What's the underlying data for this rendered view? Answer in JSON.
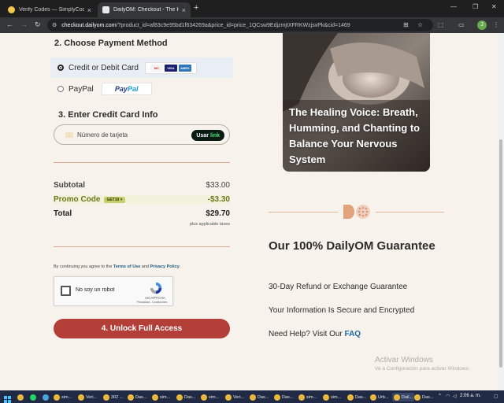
{
  "browser": {
    "tabs": [
      {
        "title": "Verify Codes — SimplyCodes",
        "active": false
      },
      {
        "title": "DailyOM: Checkout - The Heali",
        "active": true
      }
    ],
    "url_host": "checkout.dailyom.com",
    "url_rest": "/?product_id=af83c9e95bd1f634269a&price_id=price_1QCsw9EdjzmjtXFRKWzjsxPk&cid=1469"
  },
  "payment": {
    "section_title": "2. Choose Payment Method",
    "options": [
      {
        "label": "Credit or Debit Card",
        "selected": true
      },
      {
        "label": "PayPal",
        "selected": false
      }
    ],
    "card_brands": [
      "MC",
      "VISA",
      "AMEX"
    ],
    "paypal_logo": [
      "Pay",
      "Pal"
    ]
  },
  "card_info": {
    "section_title": "3. Enter Credit Card Info",
    "placeholder": "Número de tarjeta",
    "link_button": {
      "prefix": "Usar",
      "brand": "link"
    }
  },
  "summary": {
    "subtotal_label": "Subtotal",
    "subtotal_value": "$33.00",
    "promo_label": "Promo Code",
    "promo_code": "GET10 ×",
    "promo_value": "-$3.30",
    "total_label": "Total",
    "total_value": "$29.70",
    "taxes_note": "plus applicable taxes"
  },
  "terms": {
    "prefix": "By continuing you agree to the ",
    "terms_link": "Terms of Use",
    "and": " and ",
    "privacy_link": "Privacy Policy",
    "suffix": "."
  },
  "captcha": {
    "label": "No soy un robot",
    "brand": "reCAPTCHA",
    "privacy": "Privacidad - Condiciones"
  },
  "cta": {
    "label": "4. Unlock Full Access"
  },
  "hero": {
    "title": "The Healing Voice: Breath, Humming, and Chanting to Balance Your Nervous System"
  },
  "guarantee": {
    "title": "Our 100% DailyOM Guarantee",
    "items": [
      "30-Day Refund or Exchange Guarantee",
      "Your Information Is Secure and Encrypted"
    ],
    "help_prefix": "Need Help? Visit Our ",
    "help_link": "FAQ"
  },
  "watermark": {
    "title": "Activar Windows",
    "subtitle": "Ve a Configuración para activar Windows."
  },
  "taskbar": {
    "items": [
      "sim...",
      "Veri...",
      "302 ...",
      "Das...",
      "sim...",
      "Das...",
      "sim...",
      "Veri...",
      "Das...",
      "Das...",
      "sim...",
      "sim...",
      "Das...",
      "Urb...",
      "Dail...",
      "Das..."
    ],
    "clock": "2:06 a. m."
  },
  "colors": {
    "page_bg": "#f7f2ec",
    "cta": "#b43e38",
    "promo": "#6a7a1b",
    "accent_line": "#e0a88a",
    "link": "#1b5b84"
  }
}
